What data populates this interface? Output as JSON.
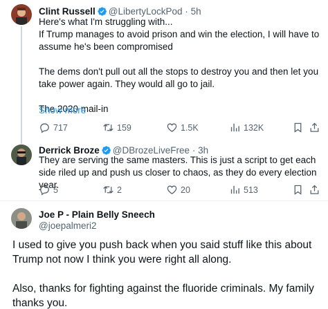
{
  "tweet1": {
    "name": "Clint Russell",
    "handle": "@LibertyLockPod",
    "separator": "·",
    "time": "5h",
    "text": "Here's what I'm struggling with...\nIf Trump manages to avoid prison and win the election, I will have to assume he's been compromised\n\nThe dems don't pull out all the stops to destroy you and then let you take power again. They would all go to jail.\n\nThe 2020 mail-in",
    "show_more": "Show more",
    "replies": "717",
    "reposts": "159",
    "likes": "1.5K",
    "views": "132K"
  },
  "tweet2": {
    "name": "Derrick Broze",
    "handle": "@DBrozeLiveFree",
    "separator": "·",
    "time": "3h",
    "text": "They are serving the same masters. This is just a script to get each side riled up and push us closer to chaos, as they do every election year.",
    "replies": "5",
    "reposts": "2",
    "likes": "20",
    "views": "513"
  },
  "tweet3": {
    "name": "Joe P - Plain Belly Sneech",
    "handle": "@joepalmeri2",
    "text": "I used to give you push back when you said stuff like this about Trump not now I think you were right all along.\n\nAlso, thanks for fighting against the fluoride criminals. My family thanks you."
  },
  "icons": {
    "reply": "reply-icon",
    "repost": "repost-icon",
    "like": "heart-icon",
    "views": "views-icon",
    "bookmark": "bookmark-icon",
    "share": "share-icon",
    "verified": "verified-badge-icon"
  },
  "colors": {
    "accent": "#1d9bf0",
    "secondary_text": "#536471",
    "text": "#0f1419"
  }
}
